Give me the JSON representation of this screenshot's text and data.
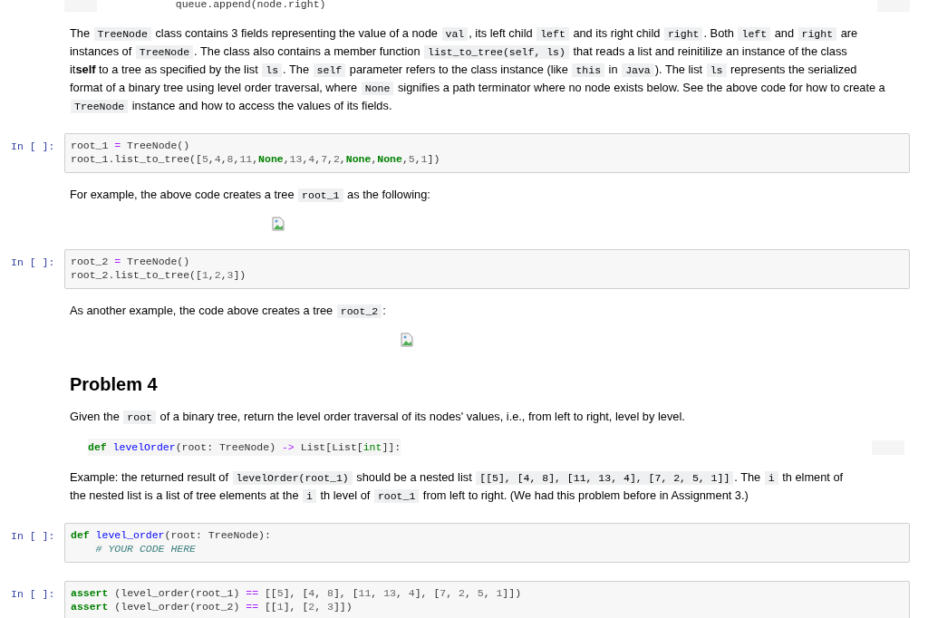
{
  "cells": [
    {
      "kind": "code_tail",
      "lines": [
        [
          {
            "kind": "p",
            "t": "            queue.append(node.right)"
          }
        ]
      ]
    },
    {
      "kind": "markdown",
      "lines": [
        [
          {
            "text": "The "
          },
          {
            "code": "TreeNode"
          },
          {
            "text": " class contains 3 fields representing the value of a node "
          },
          {
            "code": "val"
          },
          {
            "text": ", its left child "
          },
          {
            "code": "left"
          },
          {
            "text": " and its right child "
          },
          {
            "code": "right"
          },
          {
            "text": ". Both "
          },
          {
            "code": "left"
          },
          {
            "text": " and "
          },
          {
            "code": "right"
          },
          {
            "text": " are"
          }
        ],
        [
          {
            "text": "instances of "
          },
          {
            "code": "TreeNode"
          },
          {
            "text": ". The class also contains a member function "
          },
          {
            "code": "list_to_tree(self, ls)"
          },
          {
            "text": " that reads a list and reinitilize an instance of the class"
          }
        ],
        [
          {
            "text": "it**self** to a tree as specified by the list "
          },
          {
            "code": "ls"
          },
          {
            "text": ". The "
          },
          {
            "code": "self"
          },
          {
            "text": " parameter refers to the class instance (like "
          },
          {
            "code": "this"
          },
          {
            "text": " in "
          },
          {
            "code": "Java"
          },
          {
            "text": "). The list "
          },
          {
            "code": "ls"
          },
          {
            "text": " represents the serialized"
          }
        ],
        [
          {
            "text": "format of a binary tree using level order traversal, where "
          },
          {
            "code": "None"
          },
          {
            "text": " signifies a path terminator where no node exists below. See the above code for how to create a"
          }
        ],
        [
          {
            "code": "TreeNode"
          },
          {
            "text": " instance and how to access the values of its fields."
          }
        ]
      ]
    },
    {
      "kind": "code",
      "prompt": "In [ ]:",
      "lines": [
        [
          {
            "kind": "p",
            "t": "root_1 "
          },
          {
            "kind": "op",
            "t": "="
          },
          {
            "kind": "p",
            "t": " TreeNode()"
          }
        ],
        [
          {
            "kind": "p",
            "t": "root_1.list_to_tree(["
          },
          {
            "kind": "num",
            "t": "5"
          },
          {
            "kind": "p",
            "t": ","
          },
          {
            "kind": "num",
            "t": "4"
          },
          {
            "kind": "p",
            "t": ","
          },
          {
            "kind": "num",
            "t": "8"
          },
          {
            "kind": "p",
            "t": ","
          },
          {
            "kind": "num",
            "t": "11"
          },
          {
            "kind": "p",
            "t": ","
          },
          {
            "kind": "kw",
            "t": "None"
          },
          {
            "kind": "p",
            "t": ","
          },
          {
            "kind": "num",
            "t": "13"
          },
          {
            "kind": "p",
            "t": ","
          },
          {
            "kind": "num",
            "t": "4"
          },
          {
            "kind": "p",
            "t": ","
          },
          {
            "kind": "num",
            "t": "7"
          },
          {
            "kind": "p",
            "t": ","
          },
          {
            "kind": "num",
            "t": "2"
          },
          {
            "kind": "p",
            "t": ","
          },
          {
            "kind": "kw",
            "t": "None"
          },
          {
            "kind": "p",
            "t": ","
          },
          {
            "kind": "kw",
            "t": "None"
          },
          {
            "kind": "p",
            "t": ","
          },
          {
            "kind": "num",
            "t": "5"
          },
          {
            "kind": "p",
            "t": ","
          },
          {
            "kind": "num",
            "t": "1"
          },
          {
            "kind": "p",
            "t": "])"
          }
        ]
      ]
    },
    {
      "kind": "markdown",
      "lines": [
        [
          {
            "text": "For example, the above code creates a tree "
          },
          {
            "code": "root_1"
          },
          {
            "text": " as the following:"
          }
        ]
      ]
    },
    {
      "kind": "image"
    },
    {
      "kind": "code",
      "prompt": "In [ ]:",
      "lines": [
        [
          {
            "kind": "p",
            "t": "root_2 "
          },
          {
            "kind": "op",
            "t": "="
          },
          {
            "kind": "p",
            "t": " TreeNode()"
          }
        ],
        [
          {
            "kind": "p",
            "t": "root_2.list_to_tree(["
          },
          {
            "kind": "num",
            "t": "1"
          },
          {
            "kind": "p",
            "t": ","
          },
          {
            "kind": "num",
            "t": "2"
          },
          {
            "kind": "p",
            "t": ","
          },
          {
            "kind": "num",
            "t": "3"
          },
          {
            "kind": "p",
            "t": "])"
          }
        ]
      ]
    },
    {
      "kind": "markdown",
      "lines": [
        [
          {
            "text": "As another example, the code above creates a tree "
          },
          {
            "code": "root_2"
          },
          {
            "text": ":"
          }
        ]
      ]
    },
    {
      "kind": "image"
    },
    {
      "kind": "heading",
      "text": "Problem 4"
    },
    {
      "kind": "markdown",
      "lines": [
        [
          {
            "text": "Given the "
          },
          {
            "code": "root"
          },
          {
            "text": " of a binary tree, return the level order traversal of its nodes' values, i.e., from left to right, level by level."
          }
        ]
      ]
    },
    {
      "kind": "pre",
      "lines": [
        [
          {
            "kind": "kw",
            "t": "def "
          },
          {
            "kind": "fn",
            "t": "levelOrder"
          },
          {
            "kind": "p",
            "t": "(root: TreeNode) "
          },
          {
            "kind": "op",
            "t": "->"
          },
          {
            "kind": "p",
            "t": " List[List["
          },
          {
            "kind": "bi",
            "t": "int"
          },
          {
            "kind": "p",
            "t": "]]:"
          }
        ]
      ]
    },
    {
      "kind": "markdown",
      "lines": [
        [
          {
            "text": "Example: the returned result of "
          },
          {
            "code": "levelOrder(root_1)"
          },
          {
            "text": " should be a nested list "
          },
          {
            "code": "[[5], [4, 8], [11, 13, 4], [7, 2, 5, 1]]"
          },
          {
            "text": ". The "
          },
          {
            "code": "i"
          },
          {
            "text": " th elment of"
          }
        ],
        [
          {
            "text": "the nested list is a list of tree elements at the "
          },
          {
            "code": "i"
          },
          {
            "text": " th level of "
          },
          {
            "code": "root_1"
          },
          {
            "text": " from left to right. (We had this problem before in Assignment 3.)"
          }
        ]
      ]
    },
    {
      "kind": "code",
      "prompt": "In [ ]:",
      "lines": [
        [
          {
            "kind": "kw",
            "t": "def "
          },
          {
            "kind": "fn",
            "t": "level_order"
          },
          {
            "kind": "p",
            "t": "(root: TreeNode):"
          }
        ],
        [
          {
            "kind": "cm",
            "t": "    # YOUR CODE HERE"
          }
        ]
      ]
    },
    {
      "kind": "code",
      "prompt": "In [ ]:",
      "lines": [
        [
          {
            "kind": "kw",
            "t": "assert"
          },
          {
            "kind": "p",
            "t": " (level_order(root_1) "
          },
          {
            "kind": "op",
            "t": "=="
          },
          {
            "kind": "p",
            "t": " [["
          },
          {
            "kind": "num",
            "t": "5"
          },
          {
            "kind": "p",
            "t": "], ["
          },
          {
            "kind": "num",
            "t": "4"
          },
          {
            "kind": "p",
            "t": ", "
          },
          {
            "kind": "num",
            "t": "8"
          },
          {
            "kind": "p",
            "t": "], ["
          },
          {
            "kind": "num",
            "t": "11"
          },
          {
            "kind": "p",
            "t": ", "
          },
          {
            "kind": "num",
            "t": "13"
          },
          {
            "kind": "p",
            "t": ", "
          },
          {
            "kind": "num",
            "t": "4"
          },
          {
            "kind": "p",
            "t": "], ["
          },
          {
            "kind": "num",
            "t": "7"
          },
          {
            "kind": "p",
            "t": ", "
          },
          {
            "kind": "num",
            "t": "2"
          },
          {
            "kind": "p",
            "t": ", "
          },
          {
            "kind": "num",
            "t": "5"
          },
          {
            "kind": "p",
            "t": ", "
          },
          {
            "kind": "num",
            "t": "1"
          },
          {
            "kind": "p",
            "t": "]])"
          }
        ],
        [
          {
            "kind": "kw",
            "t": "assert"
          },
          {
            "kind": "p",
            "t": " (level_order(root_2) "
          },
          {
            "kind": "op",
            "t": "=="
          },
          {
            "kind": "p",
            "t": " [["
          },
          {
            "kind": "num",
            "t": "1"
          },
          {
            "kind": "p",
            "t": "], ["
          },
          {
            "kind": "num",
            "t": "2"
          },
          {
            "kind": "p",
            "t": ", "
          },
          {
            "kind": "num",
            "t": "3"
          },
          {
            "kind": "p",
            "t": "]])"
          }
        ]
      ]
    }
  ]
}
